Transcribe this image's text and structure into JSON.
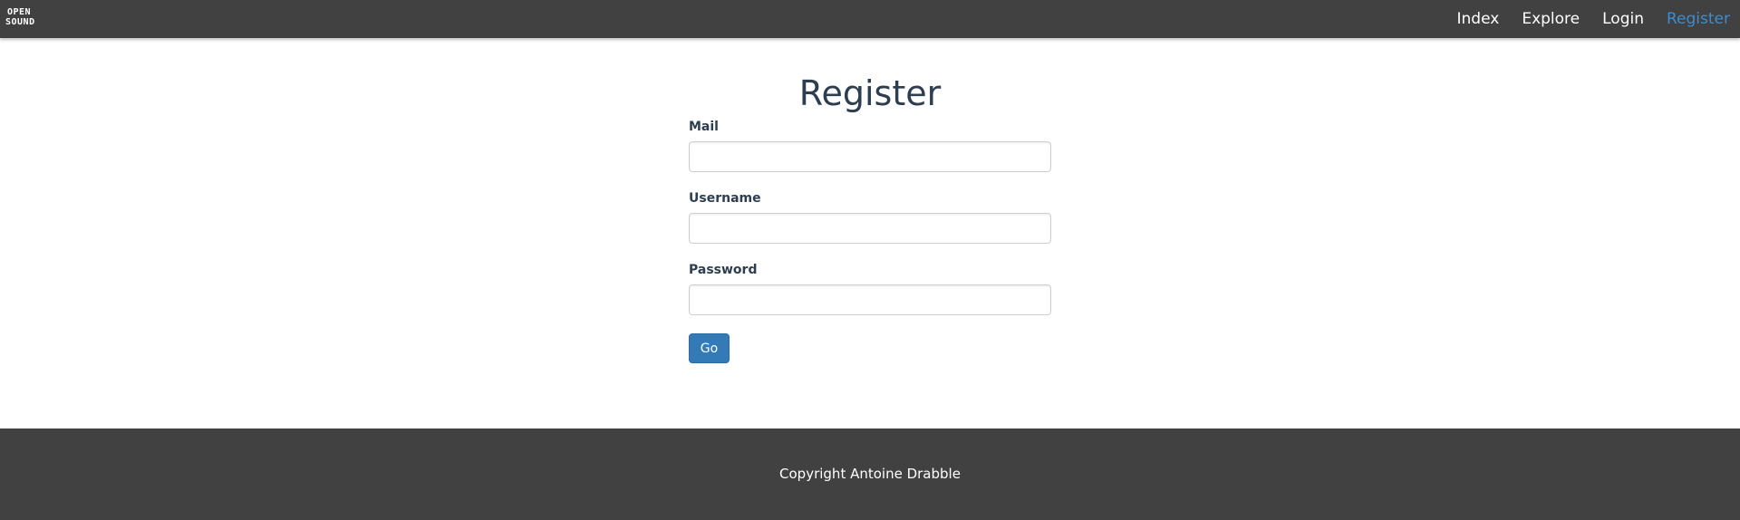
{
  "navbar": {
    "logo": {
      "line1": "OPEN",
      "line2": "SOUND"
    },
    "links": [
      {
        "label": "Index"
      },
      {
        "label": "Explore"
      },
      {
        "label": "Login"
      },
      {
        "label": "Register",
        "active": true
      }
    ]
  },
  "main": {
    "title": "Register",
    "fields": [
      {
        "label": "Mail",
        "value": "",
        "type": "email"
      },
      {
        "label": "Username",
        "value": "",
        "type": "text"
      },
      {
        "label": "Password",
        "value": "",
        "type": "password"
      }
    ],
    "submit_label": "Go"
  },
  "footer": {
    "copyright": "Copyright Antoine Drabble"
  },
  "colors": {
    "navbar_bg": "#414141",
    "active_link": "#3c8ccf",
    "heading_text": "#2c3e50",
    "button_bg": "#337ab7"
  }
}
